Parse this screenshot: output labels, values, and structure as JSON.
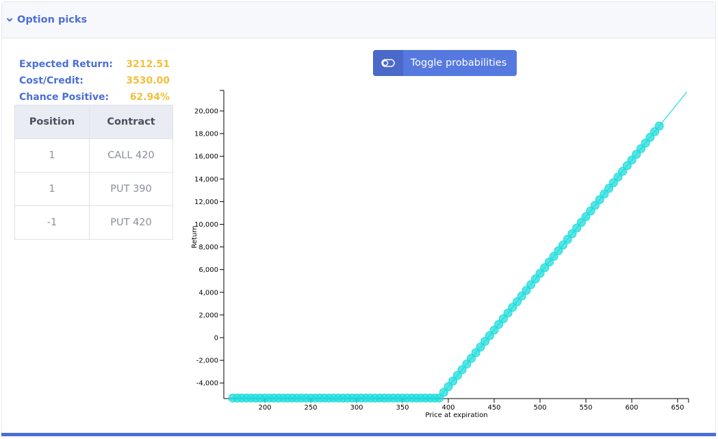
{
  "header": {
    "title": "Option picks",
    "icon": "chevron-down-icon"
  },
  "stats": [
    {
      "label": "Expected Return:",
      "value": "3212.51"
    },
    {
      "label": "Cost/Credit:",
      "value": "3530.00"
    },
    {
      "label": "Chance Positive:",
      "value": "62.94%"
    }
  ],
  "table": {
    "headers": [
      "Position",
      "Contract"
    ],
    "rows": [
      [
        "1",
        "CALL 420"
      ],
      [
        "1",
        "PUT 390"
      ],
      [
        "-1",
        "PUT 420"
      ]
    ]
  },
  "toggle": {
    "label": "Toggle probabilities",
    "icon": "toggle-icon"
  },
  "colors": {
    "accent": "#4a6fd6",
    "value": "#f2bf3a",
    "series": "#1fdcdc"
  },
  "chart_data": {
    "type": "scatter",
    "xlabel": "Price at expiration",
    "ylabel": "Return",
    "xlim": [
      160,
      660
    ],
    "ylim": [
      -5500,
      22000
    ],
    "x_ticks": [
      200,
      250,
      300,
      350,
      400,
      450,
      500,
      550,
      600,
      650
    ],
    "y_ticks": [
      -4000,
      -2000,
      0,
      2000,
      4000,
      6000,
      8000,
      10000,
      12000,
      14000,
      16000,
      18000,
      20000
    ],
    "x_tick_labels": [
      "200",
      "250",
      "300",
      "350",
      "400",
      "450",
      "500",
      "550",
      "600",
      "650"
    ],
    "y_tick_labels": [
      "-4,000",
      "-2,000",
      "0",
      "2,000",
      "4,000",
      "6,000",
      "8,000",
      "10,000",
      "12,000",
      "14,000",
      "16,000",
      "18,000",
      "20,000"
    ],
    "line": {
      "x": [
        165,
        390,
        660
      ],
      "y": [
        -5330,
        -5330,
        21670
      ]
    },
    "points": {
      "x_start": 165,
      "x_end": 630,
      "step": 5,
      "kink_x": 390,
      "flat_y": -5330,
      "slope": 100
    }
  }
}
